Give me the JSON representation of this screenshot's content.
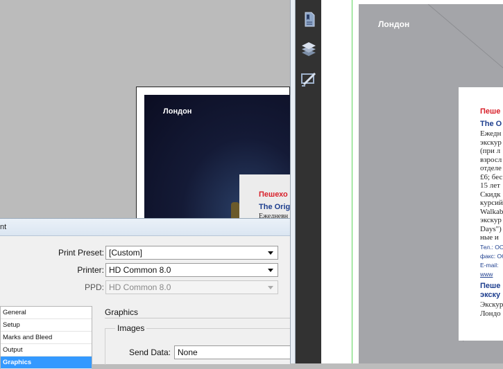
{
  "thumbnail": {
    "city": "Лондон",
    "title": "Пешехо",
    "subtitle": "The Orig",
    "body": "Ежедневн"
  },
  "dialog": {
    "title": "nt",
    "fields": [
      {
        "label": "Print Preset:",
        "value": "[Custom]",
        "disabled": false
      },
      {
        "label": "Printer:",
        "value": "HD Common 8.0",
        "disabled": false
      },
      {
        "label": "PPD:",
        "value": "HD Common 8.0",
        "disabled": true
      }
    ],
    "categories": [
      "General",
      "Setup",
      "Marks and Bleed",
      "Output",
      "Graphics"
    ],
    "selected_category": "Graphics",
    "section_title": "Graphics",
    "group_title": "Images",
    "send_data_label": "Send Data:",
    "send_data_value": "None"
  },
  "toolbar": {
    "icons": [
      "bookmarks-icon",
      "layers-icon",
      "edit-annotations-icon"
    ]
  },
  "page": {
    "city": "Лондон",
    "title": "Пеше",
    "subtitle": "The O",
    "body_lines": [
      "Ежедн",
      "экскур",
      "(при л",
      "взросл",
      "отделе",
      "£6; бес",
      "15 лет",
      "Скидк",
      "курсий",
      "Walkab",
      "экскур",
      "Days\")",
      "ные и"
    ],
    "contact_lines": [
      "Тел.: ОО",
      "факс: О6",
      "E-mail: ",
      "www"
    ],
    "title2_lines": [
      "Пеше",
      "экску"
    ],
    "body2_lines": [
      "Экскур",
      "Лондо"
    ]
  },
  "colors": {
    "accent_red": "#d8202a",
    "accent_blue": "#1d3e8e",
    "selection": "#3399ff",
    "guide_green": "#5cd65c"
  }
}
